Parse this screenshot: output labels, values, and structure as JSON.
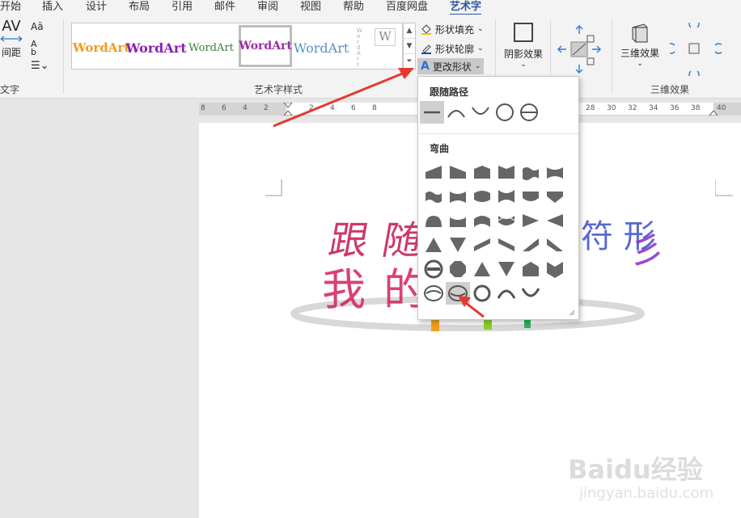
{
  "tabs": [
    {
      "label": "开始"
    },
    {
      "label": "插入"
    },
    {
      "label": "设计"
    },
    {
      "label": "布局"
    },
    {
      "label": "引用"
    },
    {
      "label": "邮件"
    },
    {
      "label": "审阅"
    },
    {
      "label": "视图"
    },
    {
      "label": "帮助"
    },
    {
      "label": "百度网盘"
    },
    {
      "label": "艺术字"
    }
  ],
  "text_group": {
    "av_label": "AV",
    "spacing_label": "间距",
    "group_label": "文字"
  },
  "wordart_styles": {
    "group_label": "艺术字样式",
    "items": [
      "WordArt",
      "WordArt",
      "WordArt",
      "WordArt",
      "WordArt",
      "W"
    ],
    "shape_fill": "形状填充",
    "shape_outline": "形状轮廓",
    "change_shape": "更改形状"
  },
  "shadow_group": {
    "label": "阴影效果"
  },
  "threed_group": {
    "button_label": "三维效果",
    "group_label": "三维效果"
  },
  "ruler_numbers": [
    "8",
    "6",
    "4",
    "2",
    "2",
    "4",
    "6",
    "8",
    "28",
    "30",
    "32",
    "34",
    "36",
    "38",
    "40"
  ],
  "dropdown": {
    "follow_path_title": "跟随路径",
    "warp_title": "弯曲"
  },
  "document_text": {
    "line1": "跟随路径",
    "line2": "我的形状"
  },
  "watermark": {
    "brand": "Baidu经验",
    "url": "jingyan.baidu.com"
  }
}
